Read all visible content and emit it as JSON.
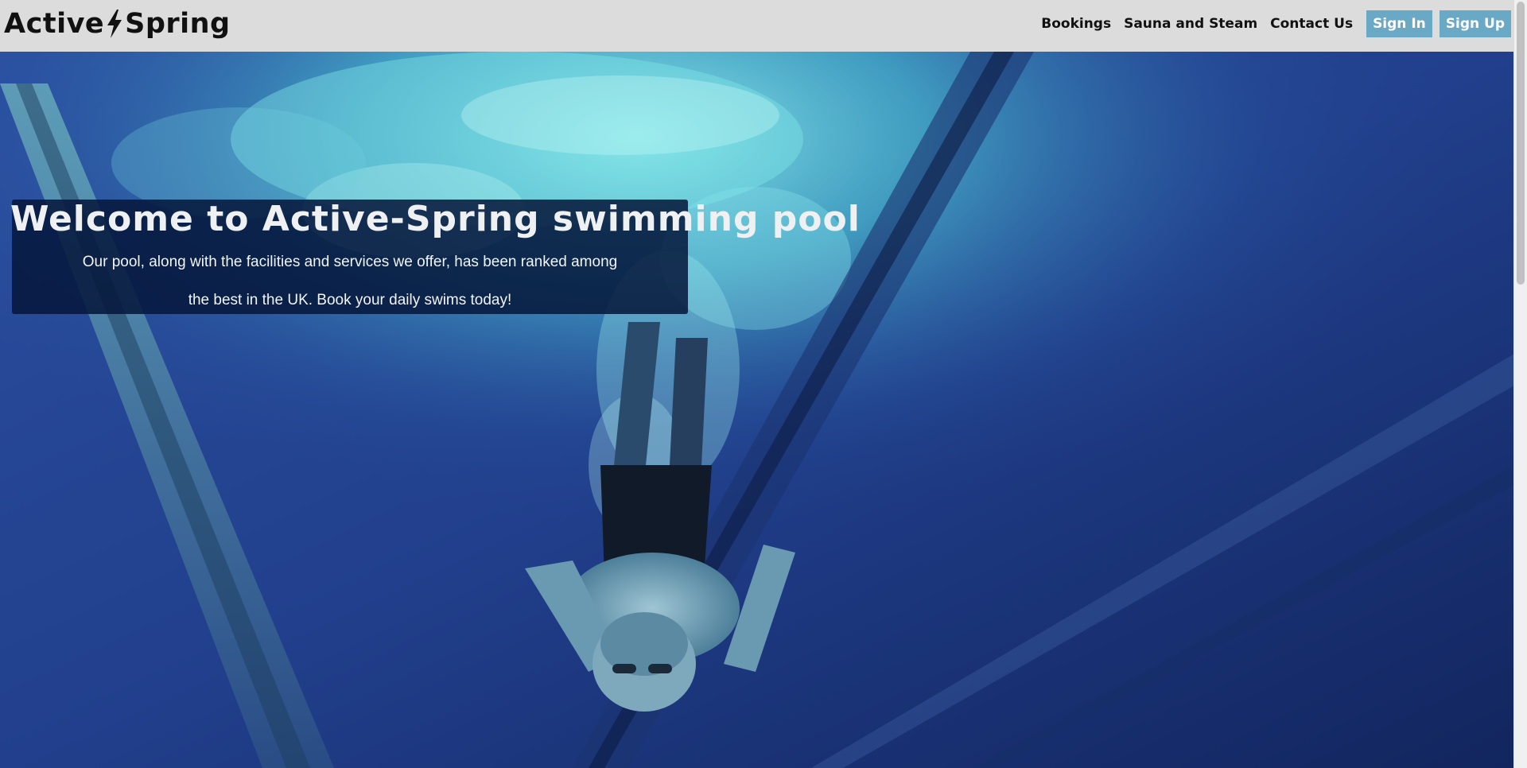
{
  "brand": {
    "name_part1": "Active",
    "name_part2": "Spring",
    "bolt_icon": "lightning-bolt-icon"
  },
  "nav": {
    "items": [
      {
        "label": "Bookings"
      },
      {
        "label": "Sauna and Steam"
      },
      {
        "label": "Contact Us"
      }
    ],
    "sign_in": "Sign In",
    "sign_up": "Sign Up"
  },
  "hero": {
    "title": "Welcome to Active-Spring swimming pool",
    "text_line1": "Our pool, along with the facilities and services we offer, has been ranked among",
    "text_line2": "the best in the UK. Book your daily swims today!"
  },
  "colors": {
    "header_bg": "#dcdcdc",
    "button_bg": "#6aa9c6",
    "overlay_bg": "#05163a",
    "water_deep": "#1f3a86",
    "water_light": "#5fd0d8"
  }
}
